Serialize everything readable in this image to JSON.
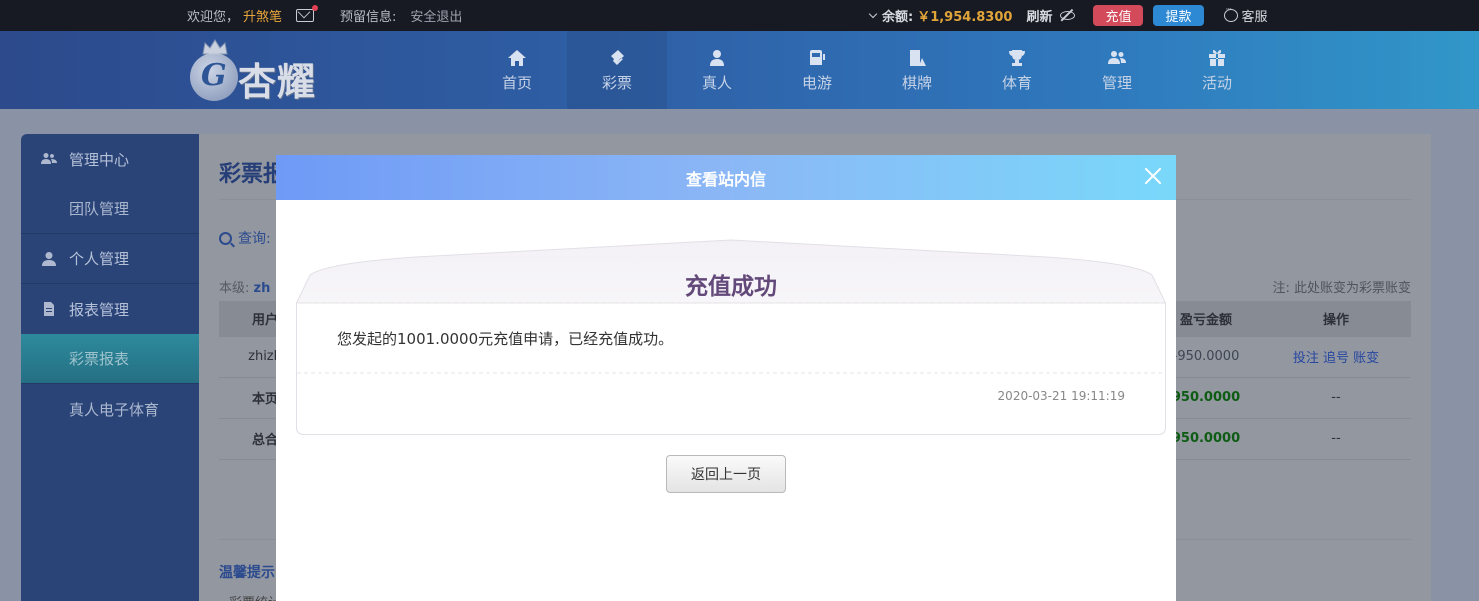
{
  "topbar": {
    "welcome": "欢迎您，",
    "username": "升煞笔",
    "reserved_label": "预留信息:",
    "logout": "安全退出",
    "balance_label": "余额:",
    "balance_value": "￥1,954.8300",
    "refresh": "刷新",
    "recharge": "充值",
    "withdraw": "提款",
    "service": "客服"
  },
  "header": {
    "brand": "杏耀",
    "nav": [
      {
        "label": "首页",
        "icon": "home-icon"
      },
      {
        "label": "彩票",
        "icon": "ticket-icon"
      },
      {
        "label": "真人",
        "icon": "dealer-icon"
      },
      {
        "label": "电游",
        "icon": "slot-icon"
      },
      {
        "label": "棋牌",
        "icon": "cards-icon"
      },
      {
        "label": "体育",
        "icon": "trophy-icon"
      },
      {
        "label": "管理",
        "icon": "users-icon"
      },
      {
        "label": "活动",
        "icon": "gift-icon"
      }
    ]
  },
  "sidebar": {
    "groups": [
      {
        "label": "管理中心",
        "icon": "users-icon"
      },
      {
        "label": "团队管理"
      },
      {
        "label": "个人管理",
        "icon": "user-icon"
      },
      {
        "label": "报表管理",
        "icon": "report-icon"
      },
      {
        "label": "彩票报表"
      },
      {
        "label": "真人电子体育"
      }
    ]
  },
  "main": {
    "title": "彩票报",
    "query_label": "查询:",
    "level_label": "本级:",
    "level_value": "zh",
    "note": "注: 此处账变为彩票账变",
    "table": {
      "headers": [
        "用户",
        "盈亏金额",
        "操作"
      ],
      "rows": [
        {
          "user": "zhizh",
          "pl": "-950.0000",
          "op": "投注 追号 账变"
        },
        {
          "user": "本页",
          "pl": "950.0000",
          "op": "--"
        },
        {
          "user": "总合",
          "pl": "950.0000",
          "op": "--"
        }
      ]
    },
    "tip": "温馨提示",
    "tip2": "彩票统计"
  },
  "modal": {
    "title": "查看站内信",
    "message_title": "充值成功",
    "message_body": "您发起的1001.0000元充值申请，已经充值成功。",
    "date": "2020-03-21 19:11:19",
    "back_button": "返回上一页"
  }
}
